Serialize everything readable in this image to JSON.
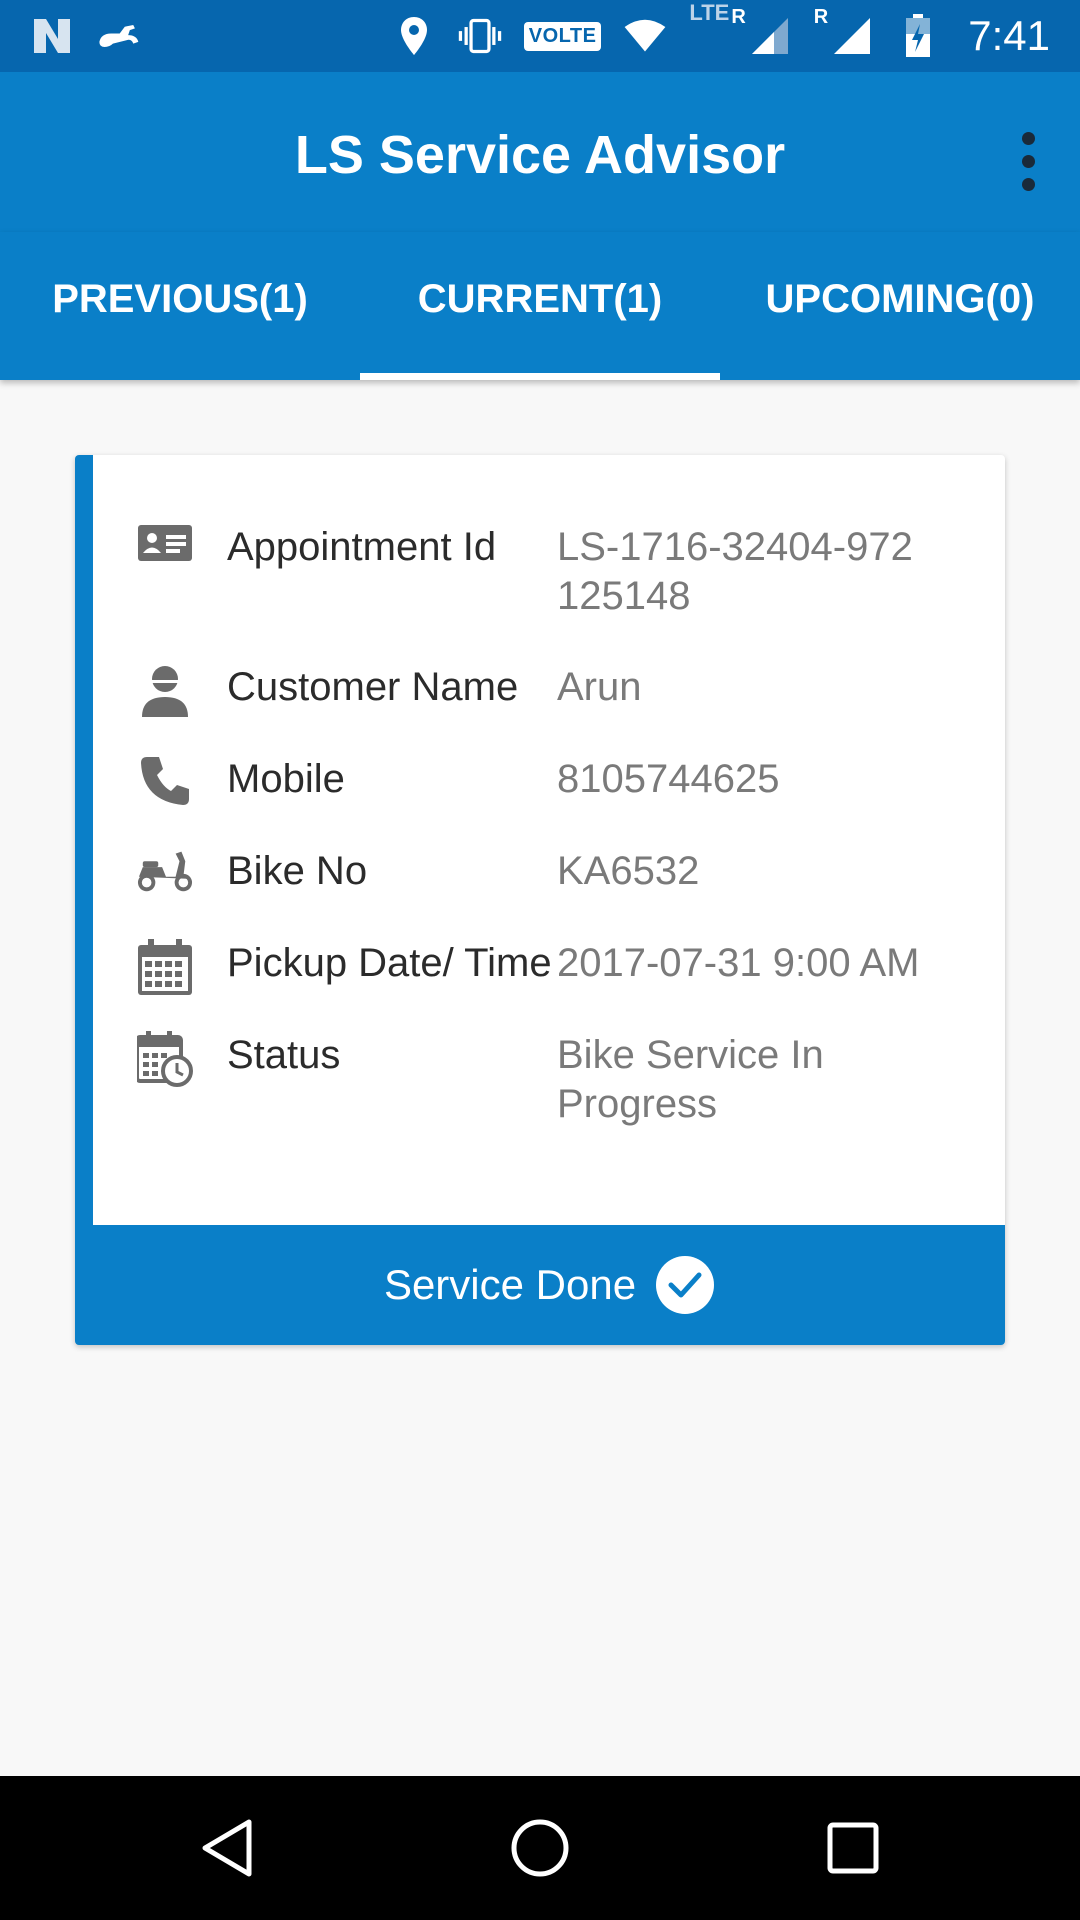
{
  "status_bar": {
    "volte": "VOLTE",
    "lte": "LTE",
    "roaming_1": "R",
    "roaming_2": "R",
    "time": "7:41",
    "icons": [
      "notification-n-icon",
      "bike-notification-icon",
      "location-icon",
      "vibrate-icon",
      "volte-icon",
      "wifi-icon",
      "signal-icon",
      "signal-icon",
      "battery-charging-icon"
    ]
  },
  "app_bar": {
    "title": "LS Service Advisor",
    "overflow_icon": "more-vert-icon"
  },
  "tabs": [
    {
      "label": "PREVIOUS(1)",
      "selected": false
    },
    {
      "label": "CURRENT(1)",
      "selected": true
    },
    {
      "label": "UPCOMING(0)",
      "selected": false
    }
  ],
  "card": {
    "accent_color": "#0a7fc8",
    "rows": [
      {
        "icon": "id-card-icon",
        "label": "Appointment Id",
        "value": "LS-1716-32404-972 125148"
      },
      {
        "icon": "person-icon",
        "label": "Customer Name",
        "value": "Arun"
      },
      {
        "icon": "phone-icon",
        "label": "Mobile",
        "value": "8105744625"
      },
      {
        "icon": "scooter-icon",
        "label": "Bike No",
        "value": "KA6532"
      },
      {
        "icon": "calendar-icon",
        "label": "Pickup Date/ Time",
        "value": "2017-07-31 9:00 AM"
      },
      {
        "icon": "calendar-clock-icon",
        "label": "Status",
        "value": "Bike Service In Progress"
      }
    ],
    "action_label": "Service Done",
    "action_icon": "check-circle-icon"
  },
  "nav_bar": {
    "icons": [
      "back-icon",
      "home-icon",
      "recents-icon"
    ]
  },
  "colors": {
    "status_bar": "#0666ae",
    "primary": "#0a7fc8",
    "background": "#f8f8f8"
  }
}
